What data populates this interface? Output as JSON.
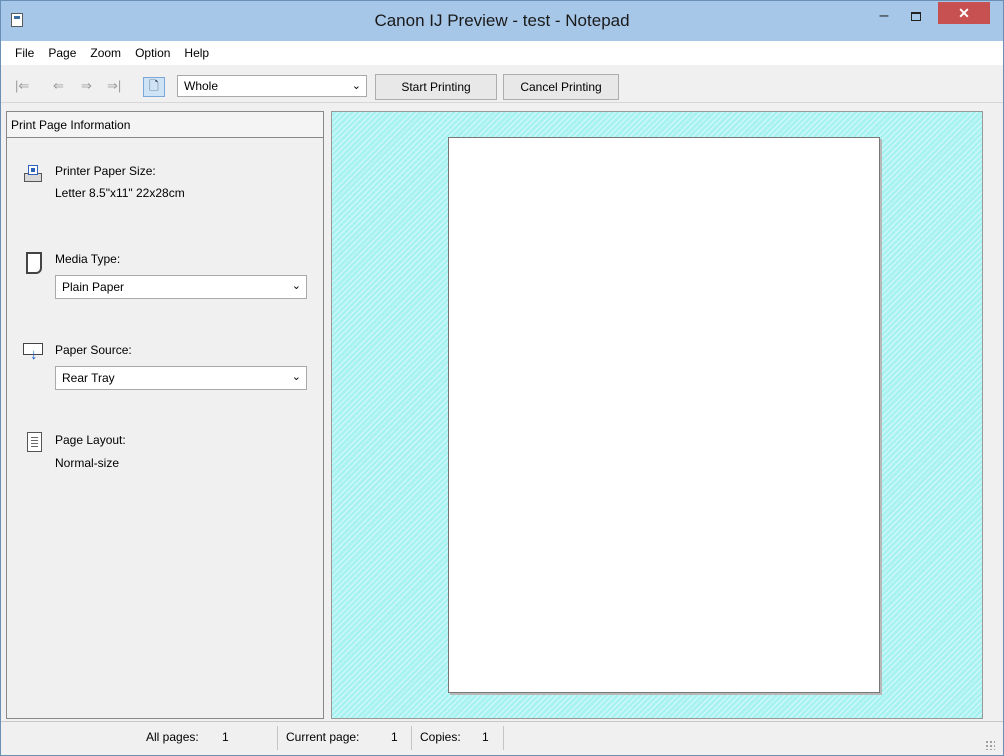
{
  "window": {
    "title": "Canon IJ Preview - test - Notepad",
    "minimize_glyph": "–",
    "close_glyph": "✕"
  },
  "menu": [
    "File",
    "Page",
    "Zoom",
    "Option",
    "Help"
  ],
  "toolbar": {
    "nav_first": "|⇐",
    "nav_prev": "⇐",
    "nav_next": "⇒",
    "nav_last": "⇒|",
    "zoom_value": "Whole",
    "start_printing": "Start Printing",
    "cancel_printing": "Cancel Printing"
  },
  "left_panel": {
    "header": "Print Page Information",
    "printer_paper_size": {
      "label": "Printer Paper Size:",
      "value": "Letter 8.5\"x11\" 22x28cm"
    },
    "media_type": {
      "label": "Media Type:",
      "value": "Plain Paper"
    },
    "paper_source": {
      "label": "Paper Source:",
      "value": "Rear Tray"
    },
    "page_layout": {
      "label": "Page Layout:",
      "value": "Normal-size"
    }
  },
  "status": {
    "all_pages_label": "All pages:",
    "all_pages_value": "1",
    "current_page_label": "Current page:",
    "current_page_value": "1",
    "copies_label": "Copies:",
    "copies_value": "1"
  },
  "colors": {
    "preview_background": "#a9f2f2",
    "titlebar": "#a7c7e8",
    "close_button": "#c75050"
  }
}
